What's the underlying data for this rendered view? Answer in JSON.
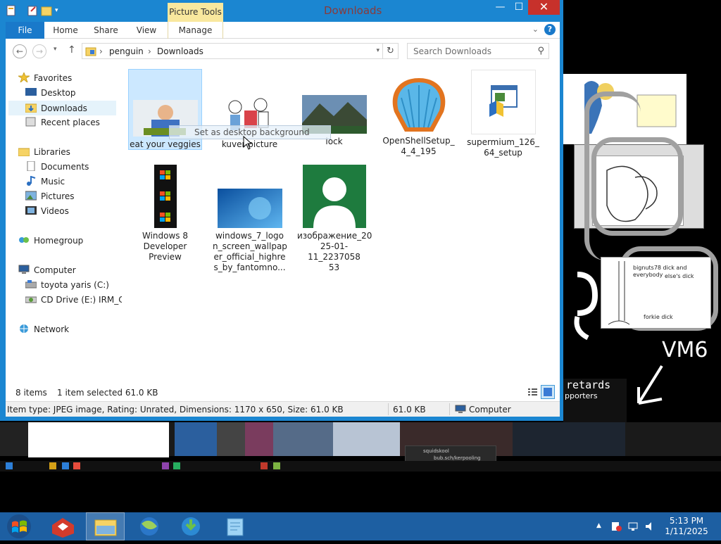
{
  "window": {
    "title": "Downloads",
    "context_tab": "Picture Tools",
    "min_glyph": "—",
    "max_glyph": "☐",
    "close_glyph": "✕"
  },
  "ribbon": {
    "tabs": [
      "File",
      "Home",
      "Share",
      "View",
      "Manage"
    ],
    "help": "?"
  },
  "address": {
    "segments": [
      "penguin",
      "Downloads"
    ],
    "sep": "›",
    "search_placeholder": "Search Downloads"
  },
  "nav": {
    "favorites": "Favorites",
    "desktop": "Desktop",
    "downloads": "Downloads",
    "recent": "Recent places",
    "libraries": "Libraries",
    "documents": "Documents",
    "music": "Music",
    "pictures": "Pictures",
    "videos": "Videos",
    "homegroup": "Homegroup",
    "computer": "Computer",
    "drive_c": "toyota yaris (C:)",
    "drive_e": "CD Drive (E:) IRM_CE",
    "network": "Network"
  },
  "files": [
    {
      "name": "eat your veggies",
      "selected": true
    },
    {
      "name": "kuver picture"
    },
    {
      "name": "lock"
    },
    {
      "name": "OpenShellSetup_4_4_195"
    },
    {
      "name": "supermium_126_64_setup"
    },
    {
      "name": "Windows 8 Developer Preview"
    },
    {
      "name": "windows_7_logon_screen_wallpaper_official_highres_by_fantomno..."
    },
    {
      "name": "изображение_2025-01-11_223705853"
    }
  ],
  "file_labels": {
    "f0": "eat your veggies",
    "f1": "kuver picture",
    "f2": "lock",
    "f3a": "OpenShellSetup_",
    "f3b": "4_4_195",
    "f4a": "supermium_126_",
    "f4b": "64_setup",
    "f5a": "Windows 8",
    "f5b": "Developer",
    "f5c": "Preview",
    "f6a": "windows_7_logo",
    "f6b": "n_screen_wallpap",
    "f6c": "er_official_highre",
    "f6d": "s_by_fantomno...",
    "f7a": "изображение_20",
    "f7b": "25-01-11_2237058",
    "f7c": "53"
  },
  "drag_tip": "Set as desktop background",
  "status": {
    "count": "8 items",
    "selection": "1 item selected  61.0 KB"
  },
  "details": {
    "info": "Item type: JPEG image, Rating: Unrated, Dimensions: 1170 x 650, Size: 61.0 KB",
    "size": "61.0 KB",
    "location": "Computer"
  },
  "taskbar": {
    "time": "5:13 PM",
    "date": "1/11/2025"
  },
  "background": {
    "retards_line1": "retards",
    "retards_line2": "pporters",
    "handwriting": "VM6",
    "doc_text_1": "bignuts78 dick and everybody",
    "doc_text_2": "else's dick",
    "doc_text_3": "forkie dick",
    "popup_title": "squidskool",
    "popup_text": "bub.sch/kerpooling"
  },
  "colors": {
    "title_blue": "#1b86d1",
    "file_tab": "#1979ca",
    "close_red": "#c7312b",
    "picture_tools": "#f9e89e",
    "selection": "#cce8ff",
    "taskbar": "#1d5fa2"
  }
}
